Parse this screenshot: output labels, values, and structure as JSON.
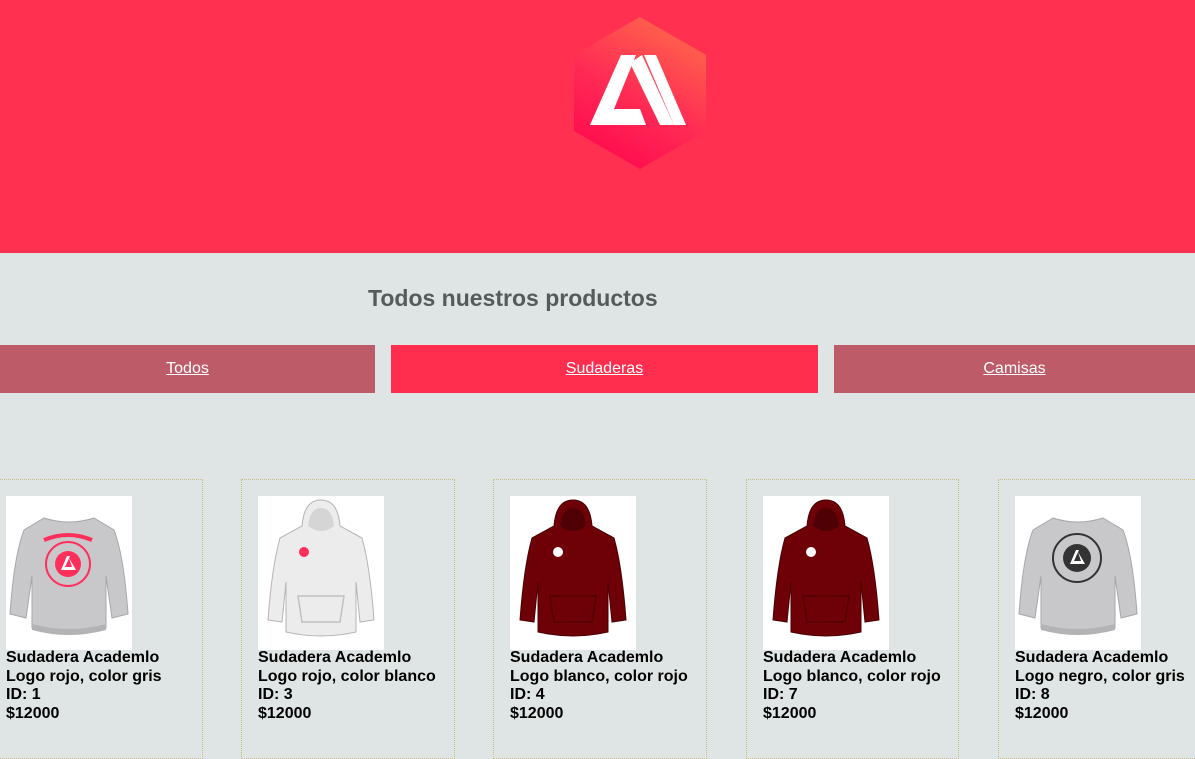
{
  "header": {
    "logo_icon": "academlo-hexagon-logo",
    "background_color": "#ff3050"
  },
  "title": "Todos nuestros productos",
  "filters": [
    {
      "label": "Todos",
      "active": false
    },
    {
      "label": "Sudaderas",
      "active": true
    },
    {
      "label": "Camisas",
      "active": false
    }
  ],
  "colors": {
    "accent": "#ff2d4e",
    "inactive_tab": "#bd5c68",
    "page_background": "#dfe5e4"
  },
  "products": [
    {
      "name_line1": "Sudadera Academlo",
      "name_line2": "Logo rojo, color gris",
      "id": "ID: 1",
      "price": "$12000",
      "image": "gray-crewneck-sweatshirt-red-logo"
    },
    {
      "name_line1": "Sudadera Academlo",
      "name_line2": "Logo rojo, color blanco",
      "id": "ID: 3",
      "price": "$12000",
      "image": "white-hoodie-red-logo"
    },
    {
      "name_line1": "Sudadera Academlo",
      "name_line2": "Logo blanco, color rojo",
      "id": "ID: 4",
      "price": "$12000",
      "image": "maroon-hoodie-white-logo"
    },
    {
      "name_line1": "Sudadera Academlo",
      "name_line2": "Logo blanco, color rojo",
      "id": "ID: 7",
      "price": "$12000",
      "image": "maroon-hoodie-white-logo"
    },
    {
      "name_line1": "Sudadera Academlo",
      "name_line2": "Logo negro, color gris",
      "id": "ID: 8",
      "price": "$12000",
      "image": "gray-crewneck-sweatshirt-black-logo"
    }
  ]
}
